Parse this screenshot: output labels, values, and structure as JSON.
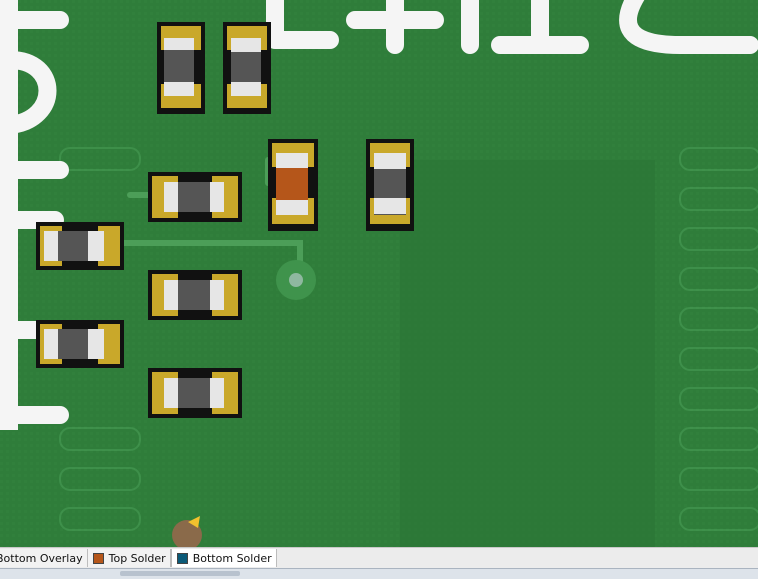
{
  "canvas": {
    "board_color": "#2f7d3a",
    "silkscreen_color": "#f5f5f5",
    "pad_color": "#c9a82a",
    "solder_mask_opening_color": "#111111",
    "component_body_color": "#555555",
    "highlight_component_color": "#b5561a"
  },
  "layer_tabs": [
    {
      "label": "Bottom Overlay",
      "swatch": "#e8e3c0"
    },
    {
      "label": "Top Solder",
      "swatch": "#b5561a"
    },
    {
      "label": "Bottom Solder",
      "swatch": "#0b5a78"
    }
  ]
}
